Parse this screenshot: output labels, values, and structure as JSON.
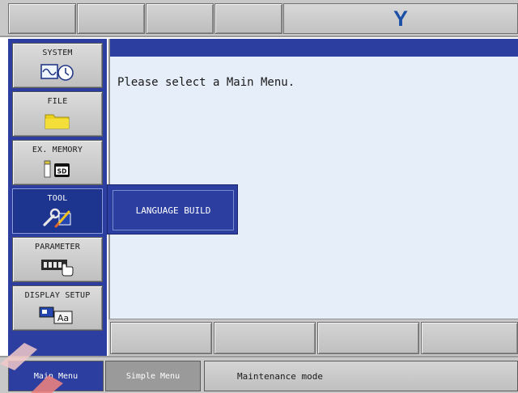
{
  "header": {
    "logo_text": "Y",
    "logo_color": "#1c4fa6",
    "buttons": [
      "",
      "",
      "",
      ""
    ]
  },
  "menu": {
    "items": [
      {
        "label": "SYSTEM",
        "icon": "system-icon"
      },
      {
        "label": "FILE",
        "icon": "folder-icon"
      },
      {
        "label": "EX. MEMORY",
        "icon": "sd-card-icon"
      },
      {
        "label": "TOOL",
        "icon": "tool-icon",
        "selected": true
      },
      {
        "label": "PARAMETER",
        "icon": "parameter-icon"
      },
      {
        "label": "DISPLAY SETUP",
        "icon": "display-setup-icon"
      }
    ]
  },
  "main": {
    "message": "Please select a Main Menu."
  },
  "submenu": {
    "items": [
      {
        "label": "LANGUAGE BUILD"
      }
    ]
  },
  "function_keys": [
    "",
    "",
    "",
    ""
  ],
  "status": {
    "main_menu": "Main Menu",
    "simple_menu": "Simple Menu",
    "mode": "Maintenance mode"
  },
  "colors": {
    "accent_blue": "#2c3fa0",
    "content_bg": "#e6eefa",
    "panel_gray": "#c8c8c8",
    "disabled_gray": "#9a9a9a"
  }
}
